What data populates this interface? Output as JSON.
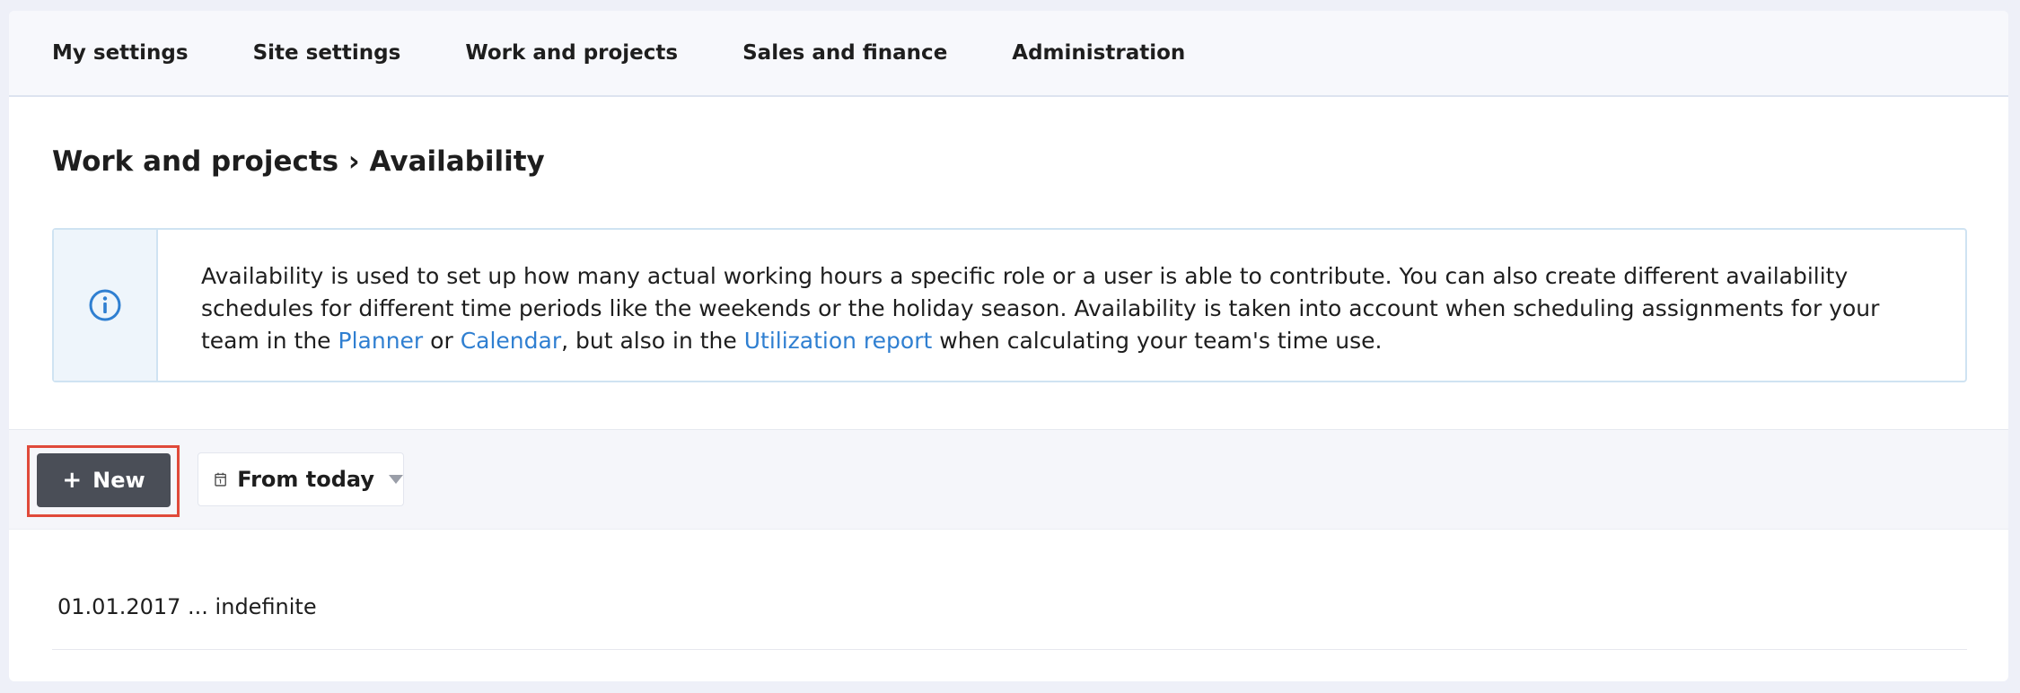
{
  "nav": {
    "items": [
      {
        "label": "My settings"
      },
      {
        "label": "Site settings"
      },
      {
        "label": "Work and projects"
      },
      {
        "label": "Sales and finance"
      },
      {
        "label": "Administration"
      }
    ]
  },
  "page": {
    "title": "Work and projects › Availability"
  },
  "info": {
    "text_1": "Availability is used to set up how many actual working hours a specific role or a user is able to contribute. You can also create different availability schedules for different time periods like the weekends or the holiday season. Availability is taken into account when scheduling assignments for your team in the ",
    "link_planner": "Planner",
    "text_2": " or ",
    "link_calendar": "Calendar",
    "text_3": ", but also in the ",
    "link_utilization": "Utilization report",
    "text_4": " when calculating your team's time use.",
    "icon": "info-icon"
  },
  "toolbar": {
    "new_label": "New",
    "new_icon": "plus-icon",
    "date_filter_label": "From today",
    "date_filter_icon": "calendar-icon"
  },
  "list": {
    "items": [
      {
        "label": "01.01.2017 ... indefinite"
      }
    ]
  },
  "colors": {
    "accent_link": "#2f7fd1",
    "button_dark": "#4a4e57",
    "highlight": "#e04a3a"
  }
}
